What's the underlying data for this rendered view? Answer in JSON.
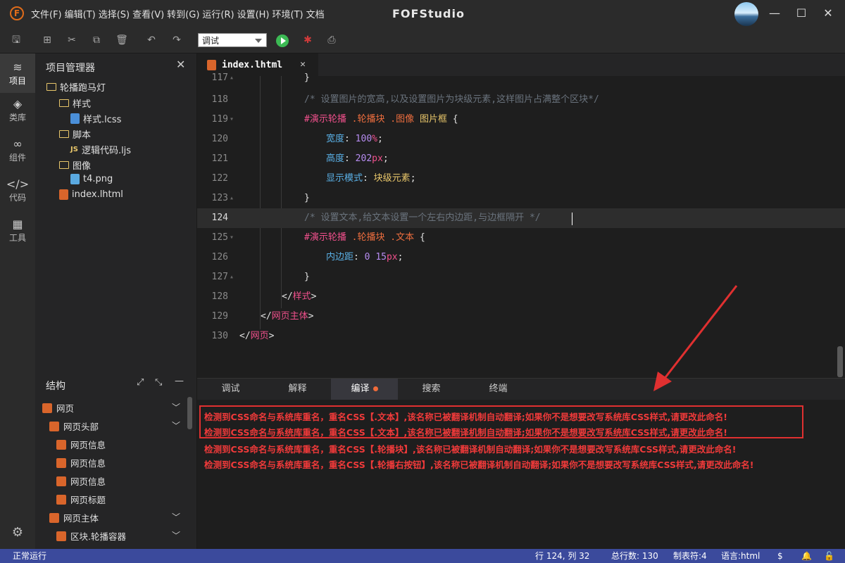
{
  "titlebar": {
    "menus": [
      "文件(F)",
      "编辑(T)",
      "选择(S)",
      "查看(V)",
      "转到(G)",
      "运行(R)",
      "设置(H)",
      "环境(T)",
      "文档"
    ],
    "app_title": "FOFStudio",
    "logo_letter": "F"
  },
  "toolbar": {
    "mode_select": "调试"
  },
  "activity": {
    "items": [
      {
        "label": "项目",
        "icon": "layers-icon"
      },
      {
        "label": "类库",
        "icon": "cube-icon"
      },
      {
        "label": "组件",
        "icon": "link-icon"
      },
      {
        "label": "代码",
        "icon": "code-icon"
      },
      {
        "label": "工具",
        "icon": "tools-icon"
      }
    ]
  },
  "project": {
    "title": "项目管理器",
    "root": "轮播跑马灯",
    "folder_styles": "样式",
    "file_style": "样式.lcss",
    "folder_scripts": "脚本",
    "file_script": "逻辑代码.ljs",
    "folder_images": "图像",
    "file_image": "t4.png",
    "file_index": "index.lhtml"
  },
  "structure": {
    "title": "结构",
    "items": [
      "网页",
      "网页头部",
      "网页信息",
      "网页信息",
      "网页信息",
      "网页标题",
      "网页主体",
      "区块.轮播容器"
    ]
  },
  "editor": {
    "tab": "index.lhtml",
    "lines": [
      {
        "n": "117",
        "t": "}"
      },
      {
        "n": "118",
        "t": "/* 设置图片的宽高,以及设置图片为块级元素,这样图片占满整个区块*/"
      },
      {
        "n": "119",
        "sel": "#演示轮播",
        "c1": " .轮播块",
        "c2": " .图像",
        "c3": " 图片框",
        "t": " {"
      },
      {
        "n": "120",
        "p": "宽度",
        "v": "100",
        "u": "%"
      },
      {
        "n": "121",
        "p": "高度",
        "v": "202",
        "u": "px"
      },
      {
        "n": "122",
        "p": "显示模式",
        "w": "块级元素"
      },
      {
        "n": "123",
        "t": "}"
      },
      {
        "n": "124",
        "t": "/* 设置文本,给文本设置一个左右内边距,与边框隔开 */"
      },
      {
        "n": "125",
        "sel": "#演示轮播",
        "c1": " .轮播块",
        "c2": " .文本",
        "t": " {"
      },
      {
        "n": "126",
        "p": "内边距",
        "v0": "0",
        "v": "15",
        "u": "px"
      },
      {
        "n": "127",
        "t": "}"
      },
      {
        "n": "128",
        "tag": "样式"
      },
      {
        "n": "129",
        "tag": "网页主体"
      },
      {
        "n": "130",
        "tag": "网页"
      }
    ]
  },
  "bottom": {
    "tabs": [
      "调试",
      "解释",
      "编译",
      "搜索",
      "终端"
    ],
    "messages": [
      "检测到CSS命名与系统库重名，重名CSS【.文本】,该名称已被翻译机制自动翻译;如果你不是想要改写系统库CSS样式,请更改此命名!",
      "检测到CSS命名与系统库重名，重名CSS【.文本】,该名称已被翻译机制自动翻译;如果你不是想要改写系统库CSS样式,请更改此命名!",
      "检测到CSS命名与系统库重名，重名CSS【.轮播块】,该名称已被翻译机制自动翻译;如果你不是想要改写系统库CSS样式,请更改此命名!",
      "检测到CSS命名与系统库重名，重名CSS【.轮播右按钮】,该名称已被翻译机制自动翻译;如果你不是想要改写系统库CSS样式,请更改此命名!"
    ]
  },
  "status": {
    "left": "正常运行",
    "position": "行 124, 列 32",
    "total": "总行数: 130",
    "tabs": "制表符:4",
    "lang": "语言:html"
  }
}
